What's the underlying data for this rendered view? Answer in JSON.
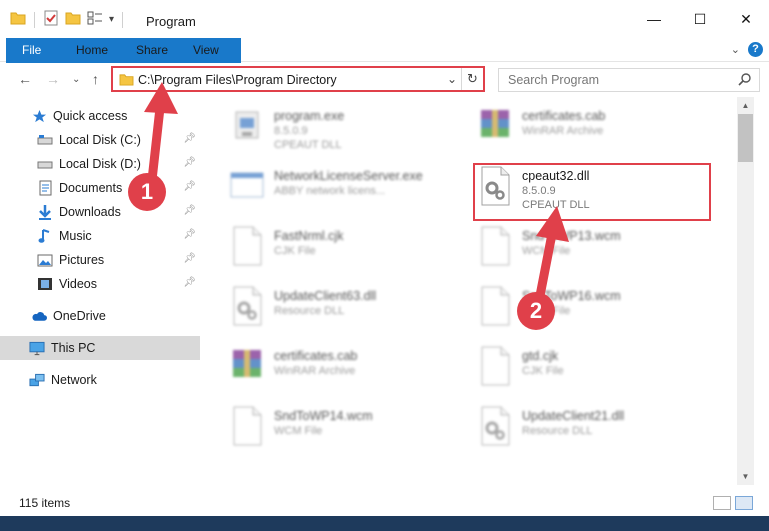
{
  "window": {
    "title": "Program"
  },
  "ribbon": {
    "file": "File",
    "home": "Home",
    "share": "Share",
    "view": "View"
  },
  "address": {
    "path": "C:\\Program Files\\Program Directory"
  },
  "search": {
    "placeholder": "Search Program"
  },
  "sidebar": {
    "items": [
      {
        "label": "Quick access"
      },
      {
        "label": "Local Disk (C:)"
      },
      {
        "label": "Local Disk (D:)"
      },
      {
        "label": "Documents"
      },
      {
        "label": "Downloads"
      },
      {
        "label": "Music"
      },
      {
        "label": "Pictures"
      },
      {
        "label": "Videos"
      },
      {
        "label": "OneDrive"
      },
      {
        "label": "This PC"
      },
      {
        "label": "Network"
      }
    ]
  },
  "files": [
    {
      "name": "program.exe",
      "l2": "8.5.0.9",
      "l3": "CPEAUT DLL",
      "icon": "exe-icon"
    },
    {
      "name": "certificates.cab",
      "l2": "WinRAR Archive",
      "l3": "",
      "icon": "winrar-icon"
    },
    {
      "name": "NetworkLicenseServer.exe",
      "l2": "ABBY network licens...",
      "l3": "",
      "icon": "window-exe-icon"
    },
    {
      "name": "cpeaut32.dll",
      "l2": "8.5.0.9",
      "l3": "CPEAUT DLL",
      "icon": "dll-gear-icon"
    },
    {
      "name": "FastNrml.cjk",
      "l2": "CJK File",
      "l3": "",
      "icon": "blank-file-icon"
    },
    {
      "name": "SndToWP13.wcm",
      "l2": "WCM File",
      "l3": "",
      "icon": "blank-file-icon"
    },
    {
      "name": "UpdateClient63.dll",
      "l2": "Resource DLL",
      "l3": "",
      "icon": "dll-gear-icon"
    },
    {
      "name": "SndToWP16.wcm",
      "l2": "WCM File",
      "l3": "",
      "icon": "blank-file-icon"
    },
    {
      "name": "certificates.cab",
      "l2": "WinRAR Archive",
      "l3": "",
      "icon": "winrar-icon"
    },
    {
      "name": "gtd.cjk",
      "l2": "CJK File",
      "l3": "",
      "icon": "blank-file-icon"
    },
    {
      "name": "SndToWP14.wcm",
      "l2": "WCM File",
      "l3": "",
      "icon": "blank-file-icon"
    },
    {
      "name": "UpdateClient21.dll",
      "l2": "Resource DLL",
      "l3": "",
      "icon": "dll-gear-icon"
    }
  ],
  "status": {
    "items": "115 items"
  },
  "annotations": {
    "badge1": "1",
    "badge2": "2",
    "color": "#e0404a"
  }
}
